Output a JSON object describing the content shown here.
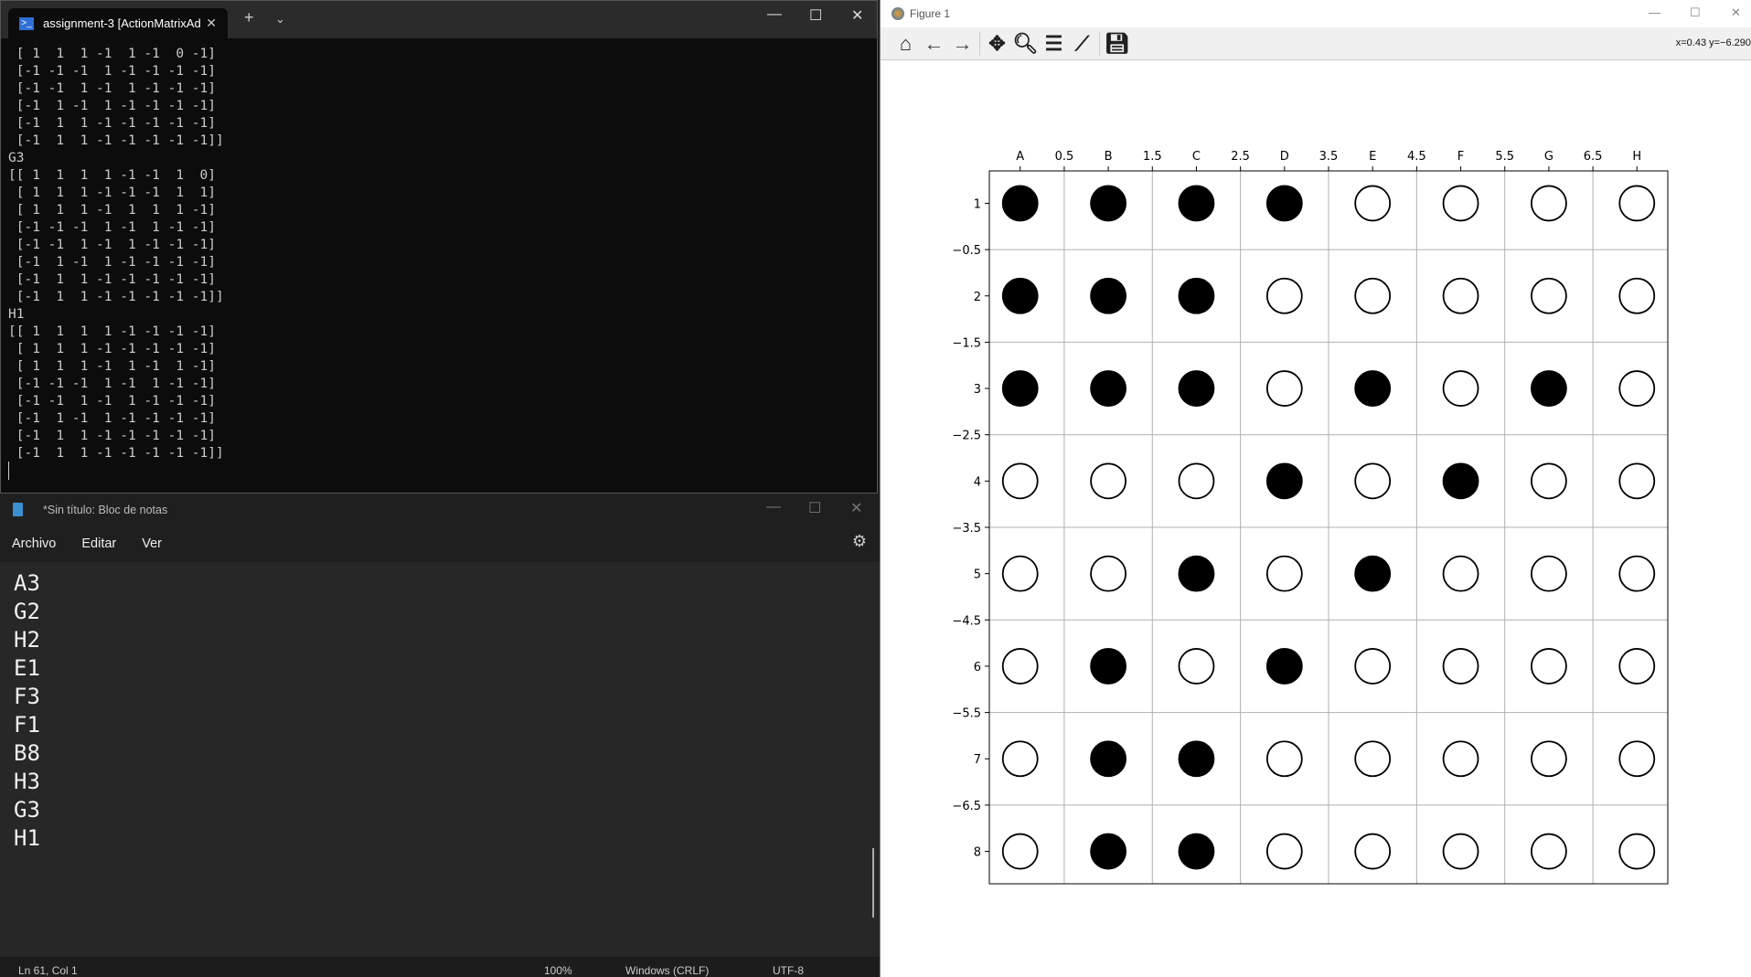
{
  "terminal": {
    "tab_title": "assignment-3 [ActionMatrixAd",
    "lines": [
      " [ 1  1  1 -1  1 -1  0 -1]",
      " [-1 -1 -1  1 -1 -1 -1 -1]",
      " [-1 -1  1 -1  1 -1 -1 -1]",
      " [-1  1 -1  1 -1 -1 -1 -1]",
      " [-1  1  1 -1 -1 -1 -1 -1]",
      " [-1  1  1 -1 -1 -1 -1 -1]]",
      "G3",
      "[[ 1  1  1  1 -1 -1  1  0]",
      " [ 1  1  1 -1 -1 -1  1  1]",
      " [ 1  1  1 -1  1  1  1 -1]",
      " [-1 -1 -1  1 -1  1 -1 -1]",
      " [-1 -1  1 -1  1 -1 -1 -1]",
      " [-1  1 -1  1 -1 -1 -1 -1]",
      " [-1  1  1 -1 -1 -1 -1 -1]",
      " [-1  1  1 -1 -1 -1 -1 -1]]",
      "H1",
      "[[ 1  1  1  1 -1 -1 -1 -1]",
      " [ 1  1  1 -1 -1 -1 -1 -1]",
      " [ 1  1  1 -1  1 -1  1 -1]",
      " [-1 -1 -1  1 -1  1 -1 -1]",
      " [-1 -1  1 -1  1 -1 -1 -1]",
      " [-1  1 -1  1 -1 -1 -1 -1]",
      " [-1  1  1 -1 -1 -1 -1 -1]",
      " [-1  1  1 -1 -1 -1 -1 -1]]"
    ]
  },
  "notepad": {
    "title": "*Sin título: Bloc de notas",
    "menu": [
      "Archivo",
      "Editar",
      "Ver"
    ],
    "lines": [
      "A3",
      "G2",
      "H2",
      "E1",
      "F3",
      "F1",
      "B8",
      "H3",
      "G3",
      "H1"
    ],
    "status": {
      "position": "Ln 61, Col 1",
      "zoom": "100%",
      "line_ending": "Windows (CRLF)",
      "encoding": "UTF-8"
    }
  },
  "figure": {
    "title": "Figure 1",
    "coords": "x=0.43 y=−6.290",
    "toolbar": [
      "home-icon",
      "back-icon",
      "forward-icon",
      "pan-icon",
      "zoom-icon",
      "configure-subplots-icon",
      "edit-axes-icon",
      "save-icon"
    ]
  },
  "chart_data": {
    "type": "scatter",
    "title": "",
    "x_tick_labels": [
      "A",
      "0.5",
      "B",
      "1.5",
      "C",
      "2.5",
      "D",
      "3.5",
      "E",
      "4.5",
      "F",
      "5.5",
      "G",
      "6.5",
      "H"
    ],
    "y_tick_labels": [
      "1",
      "−0.5",
      "2",
      "−1.5",
      "3",
      "−2.5",
      "4",
      "−3.5",
      "5",
      "−4.5",
      "6",
      "−5.5",
      "7",
      "−6.5",
      "8"
    ],
    "xlim": [
      -0.35,
      7.35
    ],
    "ylim": [
      -0.35,
      7.35
    ],
    "grid": true,
    "legend": "none",
    "board": [
      [
        1,
        1,
        1,
        1,
        -1,
        -1,
        -1,
        -1
      ],
      [
        1,
        1,
        1,
        -1,
        -1,
        -1,
        -1,
        -1
      ],
      [
        1,
        1,
        1,
        -1,
        1,
        -1,
        1,
        -1
      ],
      [
        -1,
        -1,
        -1,
        1,
        -1,
        1,
        -1,
        -1
      ],
      [
        -1,
        -1,
        1,
        -1,
        1,
        -1,
        -1,
        -1
      ],
      [
        -1,
        1,
        -1,
        1,
        -1,
        -1,
        -1,
        -1
      ],
      [
        -1,
        1,
        1,
        -1,
        -1,
        -1,
        -1,
        -1
      ],
      [
        -1,
        1,
        1,
        -1,
        -1,
        -1,
        -1,
        -1
      ]
    ],
    "colors": {
      "black_piece": "#000000",
      "white_piece": "#ffffff"
    }
  }
}
